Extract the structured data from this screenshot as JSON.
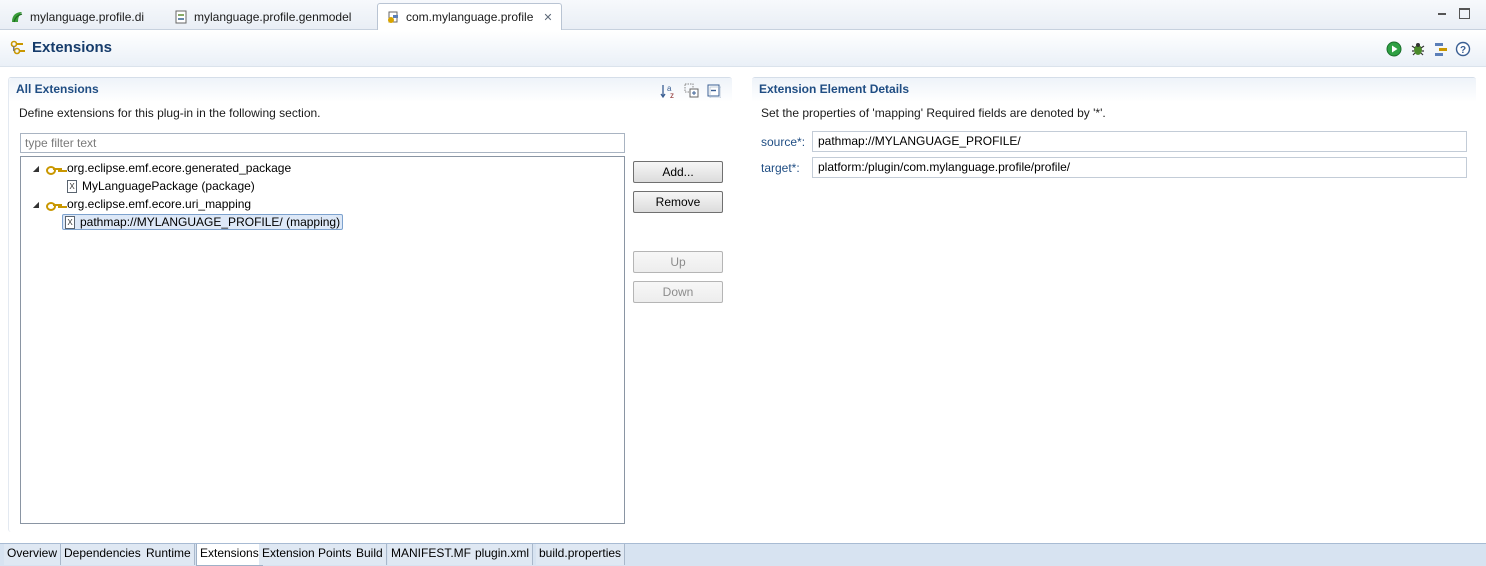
{
  "editor_tabs": [
    {
      "label": "mylanguage.profile.di",
      "icon": "papyrus-di-icon"
    },
    {
      "label": "mylanguage.profile.genmodel",
      "icon": "genmodel-file-icon"
    },
    {
      "label": "com.mylanguage.profile",
      "icon": "plugin-manifest-icon",
      "active": true
    }
  ],
  "form": {
    "title": "Extensions"
  },
  "all_extensions": {
    "title": "All Extensions",
    "description": "Define extensions for this plug-in in the following section.",
    "filter_placeholder": "type filter text",
    "tree": [
      {
        "label": "org.eclipse.emf.ecore.generated_package",
        "children": [
          {
            "label": "MyLanguagePackage (package)"
          }
        ]
      },
      {
        "label": "org.eclipse.emf.ecore.uri_mapping",
        "children": [
          {
            "label": "pathmap://MYLANGUAGE_PROFILE/ (mapping)",
            "selected": true
          }
        ]
      }
    ],
    "buttons": {
      "add": "Add...",
      "remove": "Remove",
      "up": "Up",
      "down": "Down"
    }
  },
  "details": {
    "title": "Extension Element Details",
    "description": "Set the properties of 'mapping' Required fields are denoted by '*'.",
    "fields": [
      {
        "label": "source*:",
        "value": "pathmap://MYLANGUAGE_PROFILE/"
      },
      {
        "label": "target*:",
        "value": "platform:/plugin/com.mylanguage.profile/profile/"
      }
    ]
  },
  "page_tabs": [
    "Overview",
    "Dependencies",
    "Runtime",
    "Extensions",
    "Extension Points",
    "Build",
    "MANIFEST.MF",
    "plugin.xml",
    "build.properties"
  ],
  "active_page_tab": "Extensions",
  "colors": {
    "header_title": "#163c6b",
    "section_title": "#1f4d83",
    "selection": "#dde8f7",
    "tab_bar": "#d7e3f1"
  }
}
